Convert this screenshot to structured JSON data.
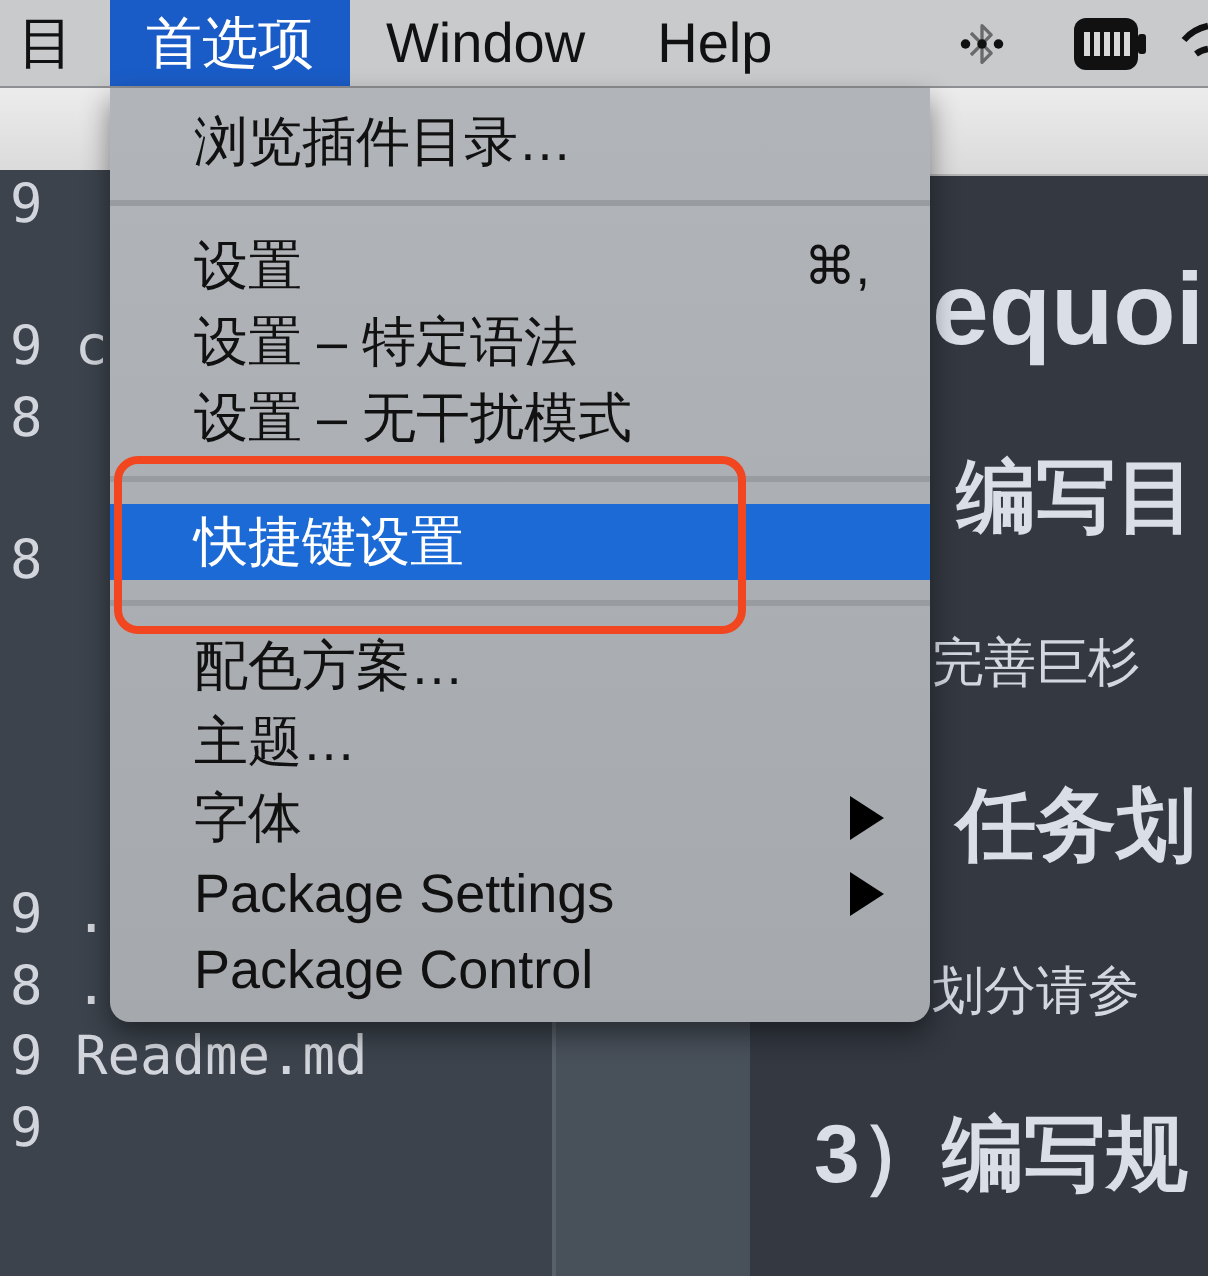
{
  "menu_bar": {
    "items": [
      {
        "label": "目",
        "selected": false
      },
      {
        "label": "首选项",
        "selected": true
      },
      {
        "label": "Window",
        "selected": false
      },
      {
        "label": "Help",
        "selected": false
      }
    ]
  },
  "file_list": {
    "lines": [
      "9",
      "9 c",
      "8",
      "8",
      "9 .",
      "8 .",
      "9 Readme.md",
      "9"
    ]
  },
  "preview": {
    "blocks": [
      {
        "kind": "title",
        "text": "equoi"
      },
      {
        "kind": "heading",
        "text": "编写目"
      },
      {
        "kind": "text",
        "text": "完善巨杉"
      },
      {
        "kind": "heading",
        "text": "任务划"
      },
      {
        "kind": "text",
        "text": "划分请参"
      },
      {
        "kind": "heading",
        "text": "3）编写规"
      }
    ]
  },
  "dropdown_menu": {
    "groups": [
      {
        "items": [
          {
            "label": "浏览插件目录…",
            "submenu": false,
            "selected": false
          }
        ]
      },
      {
        "items": [
          {
            "label": "设置",
            "shortcut": "⌘,",
            "submenu": false,
            "selected": false
          },
          {
            "label": "设置 – 特定语法",
            "submenu": false,
            "selected": false
          },
          {
            "label": "设置 – 无干扰模式",
            "submenu": false,
            "selected": false
          }
        ]
      },
      {
        "items": [
          {
            "label": "快捷键设置",
            "submenu": false,
            "selected": true
          }
        ]
      },
      {
        "items": [
          {
            "label": "配色方案…",
            "submenu": false,
            "selected": false
          },
          {
            "label": "主题…",
            "submenu": false,
            "selected": false
          },
          {
            "label": "字体",
            "submenu": true,
            "selected": false
          },
          {
            "label": "Package Settings",
            "submenu": true,
            "selected": false
          },
          {
            "label": "Package Control",
            "submenu": false,
            "selected": false
          }
        ]
      }
    ]
  }
}
